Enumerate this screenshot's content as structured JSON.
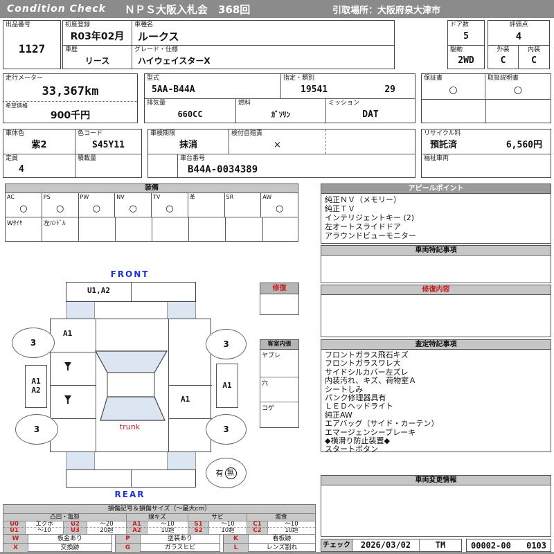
{
  "header": {
    "brand": "Condition Check",
    "title": "ＮＰＳ大阪入札会　368回",
    "pickup": "引取場所：大阪府泉大津市"
  },
  "info": {
    "lot": {
      "label": "出品番号",
      "value": "1127"
    },
    "first_reg": {
      "label": "初度登録",
      "value": "R03年02月"
    },
    "model_name": {
      "label": "車種名",
      "value": "ルークス"
    },
    "history": {
      "label": "車歴",
      "value": "リース"
    },
    "grade": {
      "label": "グレード・仕様",
      "value": "ハイウェイスターX"
    },
    "doors": {
      "label": "ドア数",
      "value": "5"
    },
    "score": {
      "label": "評価点",
      "value": "4"
    },
    "drive": {
      "label": "駆動",
      "value": "2WD"
    },
    "exterior": {
      "label": "外装",
      "value": "C"
    },
    "interior": {
      "label": "内装",
      "value": "C"
    },
    "odometer": {
      "label": "走行メーター",
      "value": "33,367km"
    },
    "price": {
      "label": "希望価格",
      "value": "900千円"
    },
    "model_code": {
      "label": "型式",
      "value": "5AA-B44A"
    },
    "type_class": {
      "label": "指定・類別",
      "value1": "19541",
      "value2": "29"
    },
    "displacement": {
      "label": "排気量",
      "value": "660CC"
    },
    "fuel": {
      "label": "燃料",
      "value": "ｶﾞｿﾘﾝ"
    },
    "mission": {
      "label": "ミッション",
      "value": "DAT"
    },
    "warranty": {
      "label": "保証書",
      "value": "○"
    },
    "manual": {
      "label": "取扱説明書",
      "value": "○"
    },
    "body_color": {
      "label": "車体色",
      "value": "紫2"
    },
    "color_code": {
      "label": "色コード",
      "value": "S45Y11"
    },
    "capacity": {
      "label": "定員",
      "value": "4"
    },
    "load": {
      "label": "積載量",
      "value": ""
    },
    "inspection": {
      "label": "車検期限",
      "value": "抹消"
    },
    "insurance": {
      "label": "検付自賠責",
      "value": "×"
    },
    "chassis": {
      "label": "車台番号",
      "value": "B44A-0034389"
    },
    "recycle": {
      "label": "リサイクル料",
      "status": "預託済",
      "fee": "6,560円"
    },
    "welfare": {
      "label": "福祉車両",
      "value": ""
    }
  },
  "equipment": {
    "title": "装備",
    "items": [
      {
        "code": "AC",
        "mark": "○"
      },
      {
        "code": "PS",
        "mark": "○"
      },
      {
        "code": "PW",
        "mark": "○"
      },
      {
        "code": "NV",
        "mark": "○"
      },
      {
        "code": "TV",
        "mark": "○"
      },
      {
        "code": "革",
        "mark": ""
      },
      {
        "code": "SR",
        "mark": ""
      },
      {
        "code": "AW",
        "mark": "○"
      }
    ],
    "extras": [
      "Wﾀｲﾔ",
      "左ﾊﾝﾄﾞﾙ",
      "",
      "",
      "",
      "",
      ""
    ]
  },
  "appeal": {
    "title": "アピールポイント",
    "lines": [
      "純正ＮＶ（メモリー）",
      "純正ＴＶ",
      "インテリジェントキー (2)",
      "左オートスライドドア",
      "アラウンドビューモニター"
    ]
  },
  "vehicle_notes": {
    "title": "車両特記事項"
  },
  "repair_content": {
    "title": "修復内容"
  },
  "assessment": {
    "title": "査定特記事項",
    "lines": [
      "フロントガラス飛石キズ",
      "フロントガラスワレ大",
      "サイドシルカバー左ズレ",
      "内装汚れ、キズ、荷物室Ａ",
      "シートしみ",
      "パンク修理器具有",
      "ＬＥＤヘッドライト",
      "純正AW",
      "エアバッグ（サイド・カーテン）",
      "エマージェンシーブレーキ",
      "◆横滑り防止装置◆",
      "スタートボタン"
    ]
  },
  "change_info": {
    "title": "車両変更情報"
  },
  "check": {
    "label": "チェック",
    "date": "2026/03/02",
    "inspector": "TM",
    "code1": "00002-00",
    "code2": "0103"
  },
  "diagram": {
    "front": "FRONT",
    "rear": "REAR",
    "trunk": "trunk",
    "front_bumper_mark": "U1,A2",
    "left_fender_mark": "A1",
    "right_panel_mark": "A1",
    "right_side_mark": "A1",
    "left_side_mark1": "A1",
    "left_side_mark2": "A2",
    "wheel_fl": "3",
    "wheel_fr": "3",
    "wheel_rl": "3",
    "wheel_rr": "3",
    "spare_yes": "有",
    "spare_no": "無",
    "repair_box_title": "修復",
    "cabin_box": {
      "title": "客室内張",
      "row1": "ヤブレ",
      "row2": "穴",
      "row3": "コゲ"
    }
  },
  "legend": {
    "title": "損傷記号＆損傷サイズ（～最大cm）",
    "groups": [
      "凸凹・亀裂",
      "線キズ",
      "サビ",
      "腐食"
    ],
    "table1": {
      "row1": [
        "U0",
        "エクボ",
        "U2",
        "～20",
        "A1",
        "～10",
        "S1",
        "～10",
        "C1",
        "～10"
      ],
      "row2": [
        "U1",
        "～10",
        "U3",
        "20超",
        "A2",
        "10超",
        "S2",
        "10超",
        "C2",
        "10超"
      ]
    },
    "table2": {
      "a1": [
        "W",
        "板金あり"
      ],
      "a2": [
        "X",
        "交換跡"
      ],
      "b1": [
        "P",
        "塗装あり"
      ],
      "b2": [
        "G",
        "ガラスヒビ"
      ],
      "c1": [
        "K",
        "看板跡"
      ],
      "c2": [
        "L",
        "レンズ割れ"
      ]
    }
  },
  "colors": {
    "accent_red": "#c81e1e",
    "accent_blue": "#2233cc",
    "shade_blue": "#dce6f2",
    "bar_gray": "#8b8b8b"
  }
}
